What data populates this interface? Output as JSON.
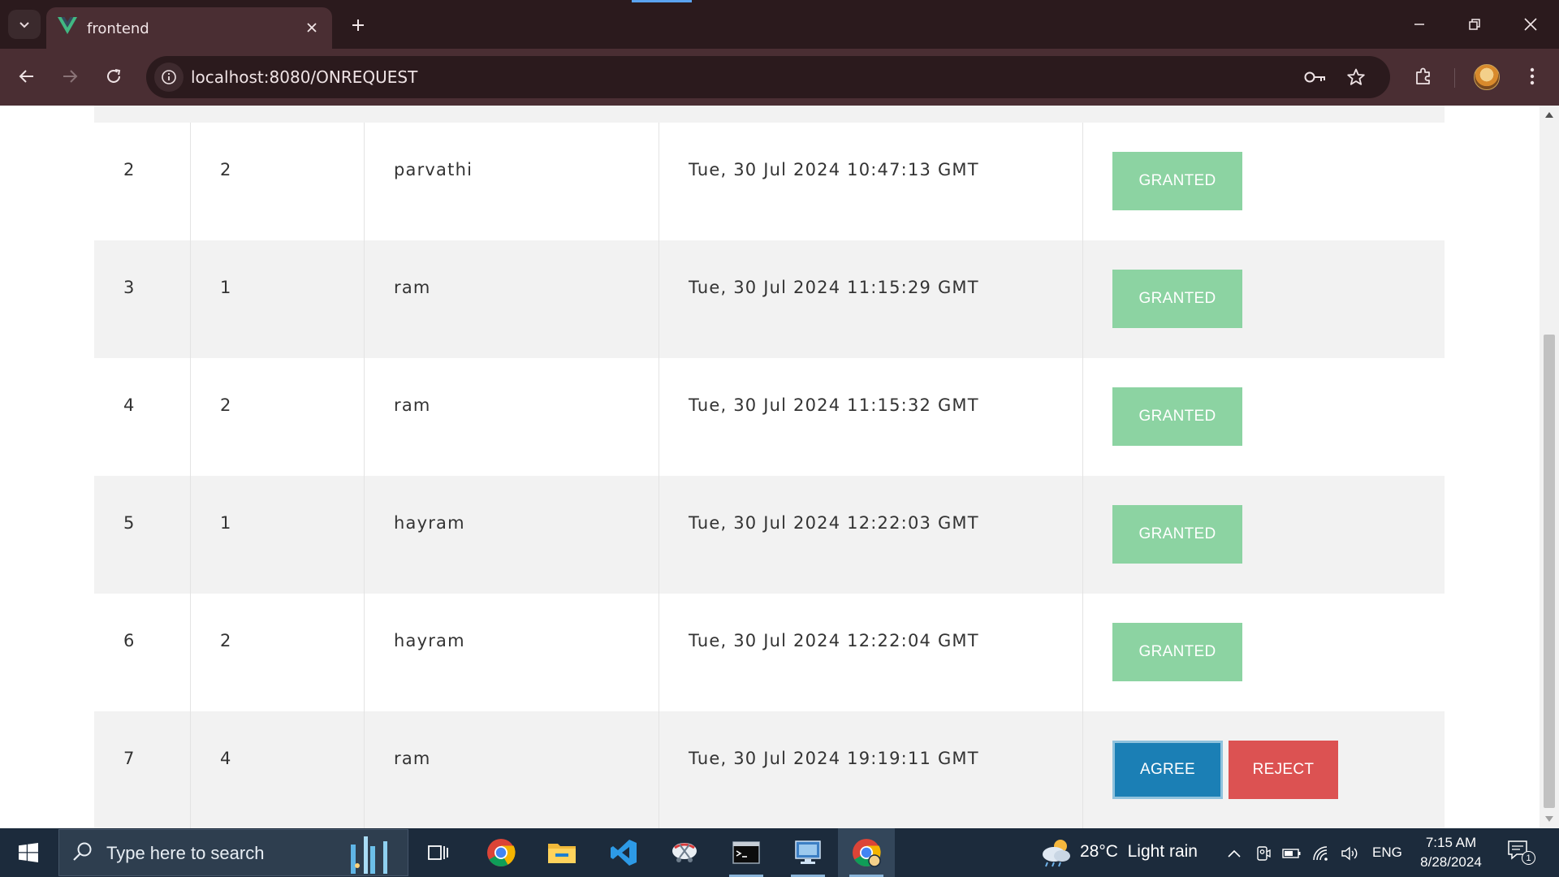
{
  "browser": {
    "tab": {
      "title": "frontend"
    },
    "address": {
      "url": "localhost:8080/ONREQUEST"
    }
  },
  "table": {
    "rows": [
      {
        "id": "2",
        "num": "2",
        "user": "parvathi",
        "timestamp": "Tue, 30 Jul 2024 10:47:13 GMT",
        "status": "GRANTED"
      },
      {
        "id": "3",
        "num": "1",
        "user": "ram",
        "timestamp": "Tue, 30 Jul 2024 11:15:29 GMT",
        "status": "GRANTED"
      },
      {
        "id": "4",
        "num": "2",
        "user": "ram",
        "timestamp": "Tue, 30 Jul 2024 11:15:32 GMT",
        "status": "GRANTED"
      },
      {
        "id": "5",
        "num": "1",
        "user": "hayram",
        "timestamp": "Tue, 30 Jul 2024 12:22:03 GMT",
        "status": "GRANTED"
      },
      {
        "id": "6",
        "num": "2",
        "user": "hayram",
        "timestamp": "Tue, 30 Jul 2024 12:22:04 GMT",
        "status": "GRANTED"
      },
      {
        "id": "7",
        "num": "4",
        "user": "ram",
        "timestamp": "Tue, 30 Jul 2024 19:19:11 GMT",
        "agree_label": "AGREE",
        "reject_label": "REJECT"
      }
    ]
  },
  "taskbar": {
    "search_placeholder": "Type here to search",
    "weather": {
      "temperature": "28°C",
      "condition": "Light rain"
    },
    "language": "ENG",
    "time": "7:15 AM",
    "date": "8/28/2024",
    "notification_count": "1"
  },
  "colors": {
    "granted": "#8cd3a2",
    "agree": "#1b7fb5",
    "reject": "#dc5252",
    "tabbar": "#2b1a1d",
    "toolbar": "#4a2e33",
    "taskbar": "#1c2b3c"
  }
}
